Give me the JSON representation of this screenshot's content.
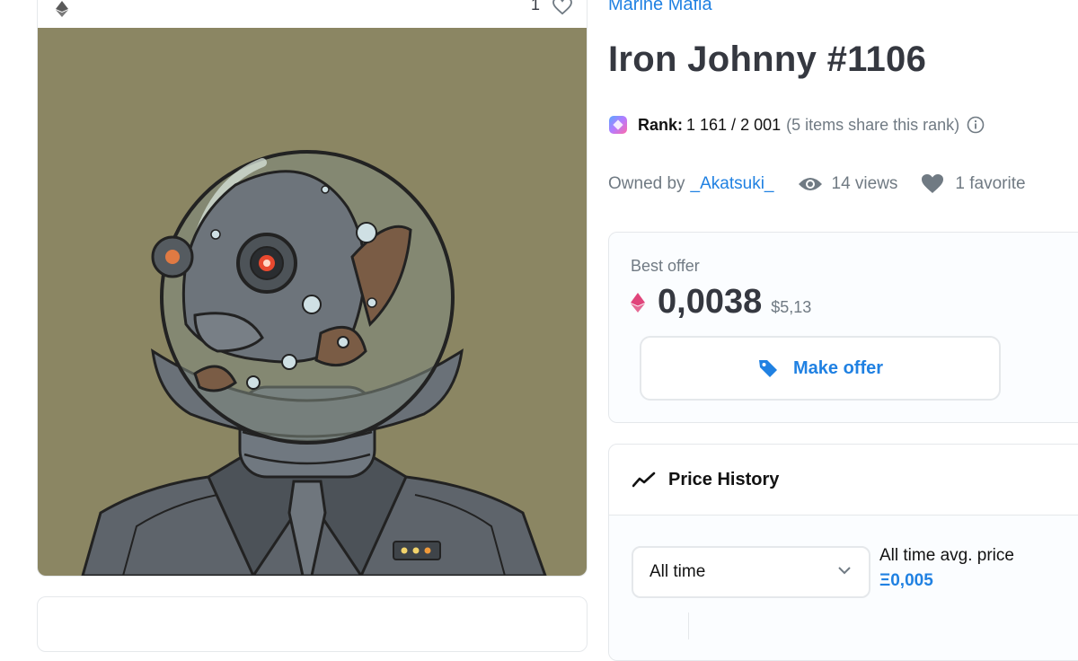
{
  "item": {
    "collection": "Marine Mafia",
    "title": "Iron Johnny #1106",
    "favorite_count": "1"
  },
  "rank": {
    "label": "Rank:",
    "value": "1 161 / 2 001",
    "share_note": "(5 items share this rank)"
  },
  "ownership": {
    "owned_by_label": "Owned by",
    "owner": "_Akatsuki_",
    "views": "14 views",
    "favorites": "1 favorite"
  },
  "offer": {
    "label": "Best offer",
    "price": "0,0038",
    "usd": "$5,13",
    "button_label": "Make offer"
  },
  "price_history": {
    "title": "Price History",
    "range": "All time",
    "avg_label": "All time avg. price",
    "avg_value": "Ξ0,005"
  },
  "icons": {
    "eth": "ethereum-icon",
    "heart": "heart-icon",
    "rank_gem": "rarity-gem-icon",
    "info": "info-icon",
    "views": "eye-icon",
    "tag": "tag-icon",
    "trend": "trend-icon",
    "chevron": "chevron-down-icon"
  },
  "colors": {
    "accent": "#2081e2",
    "eth_red": "#e0457b",
    "art_background": "#8b8663",
    "text_primary": "#353840",
    "text_secondary": "#707a83"
  }
}
